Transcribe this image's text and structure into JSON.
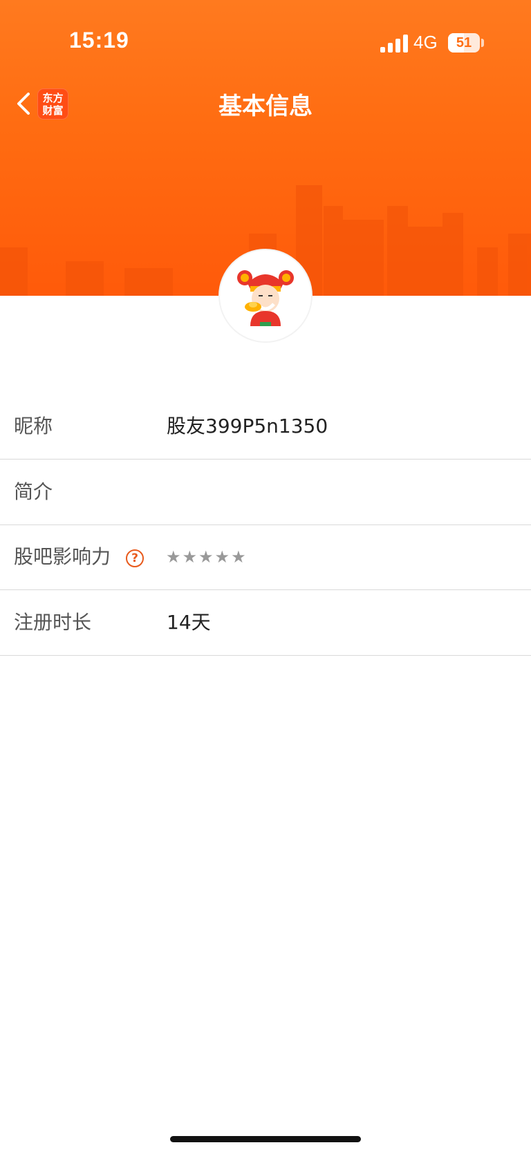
{
  "status_bar": {
    "time": "15:19",
    "network": "4G",
    "battery": "51",
    "battery_level": 0.51
  },
  "nav": {
    "title": "基本信息",
    "logo_line1": "东方",
    "logo_line2": "财富",
    "back_icon": "chevron-left-icon"
  },
  "colors": {
    "header": "#ff6d12",
    "accent": "#e85a1c",
    "divider": "#d9d9d9"
  },
  "profile": {
    "rows": [
      {
        "label": "昵称",
        "value": "股友399P5n1350"
      },
      {
        "label": "简介",
        "value": ""
      },
      {
        "label": "股吧影响力",
        "help_icon": "?",
        "rating": 0,
        "rating_max": 5
      },
      {
        "label": "注册时长",
        "value": "14天"
      }
    ]
  }
}
